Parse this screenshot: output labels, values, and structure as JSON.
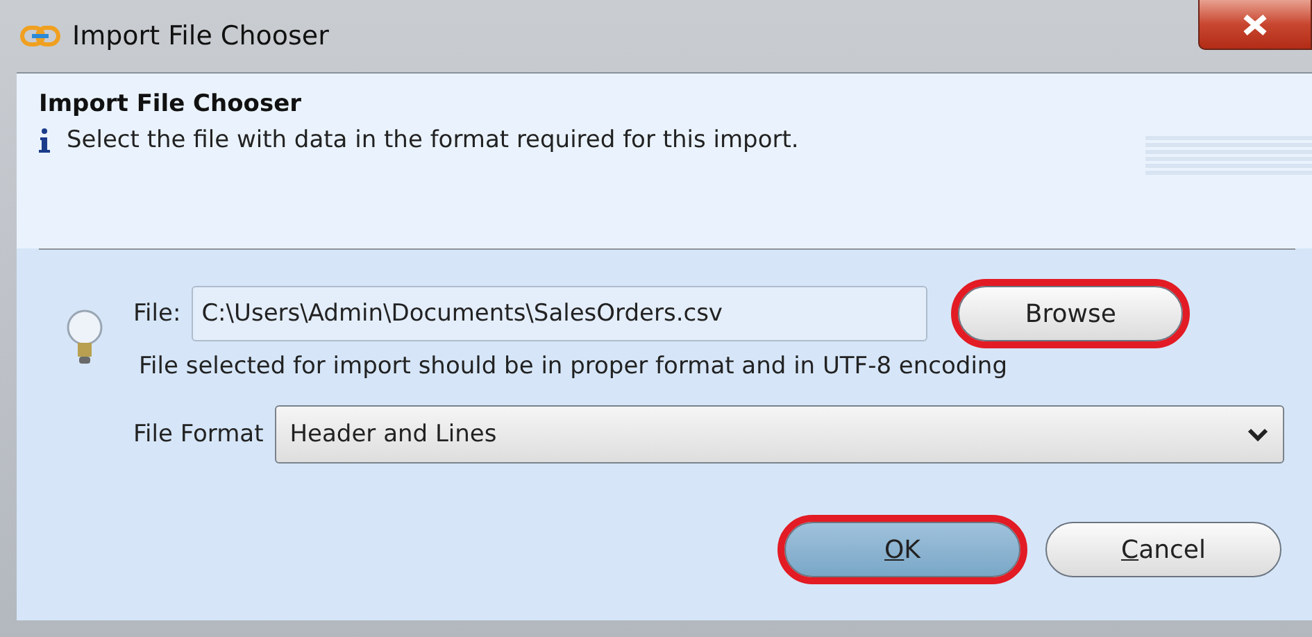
{
  "window": {
    "title": "Import File Chooser"
  },
  "header": {
    "title": "Import File Chooser",
    "info": "Select the file with data in the format required for this import."
  },
  "file": {
    "label": "File:",
    "value": "C:\\Users\\Admin\\Documents\\SalesOrders.csv",
    "hint": "File selected for import should be in proper format and in UTF-8 encoding"
  },
  "browse_button": {
    "label": "Browse",
    "highlighted": true
  },
  "format": {
    "label": "File Format",
    "value": "Header and Lines"
  },
  "buttons": [
    {
      "mnemonic": "O",
      "rest": "K",
      "default": true,
      "highlighted": true
    },
    {
      "mnemonic": "C",
      "rest": "ancel",
      "default": false,
      "highlighted": false
    }
  ]
}
